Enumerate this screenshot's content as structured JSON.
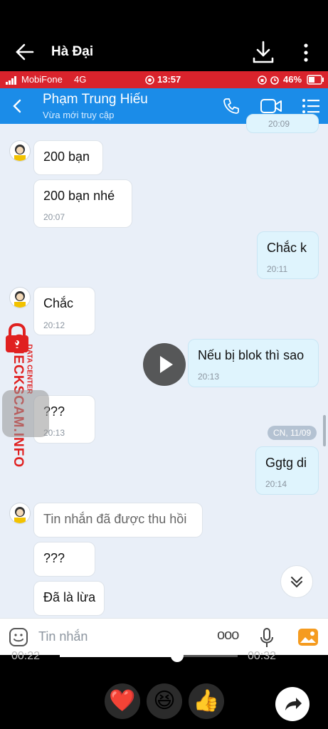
{
  "viewer": {
    "title": "Hà Đại",
    "icons": [
      "back-arrow-icon",
      "download-icon",
      "more-vert-icon"
    ]
  },
  "status_bar": {
    "carrier": "MobiFone",
    "network": "4G",
    "time": "13:57",
    "battery": "46%"
  },
  "chat_header": {
    "name": "Phạm Trung Hiếu",
    "status": "Vừa mới truy cập",
    "icons": [
      "back-icon",
      "phone-icon",
      "video-icon",
      "menu-icon"
    ]
  },
  "messages": [
    {
      "from": "them",
      "text": "200 bạn",
      "time": ""
    },
    {
      "from": "them",
      "text": "200 bạn nhé",
      "time": "20:07"
    },
    {
      "from": "me",
      "text": "Chắc k",
      "time": "20:11"
    },
    {
      "from": "them",
      "text": "Chắc",
      "time": "20:12"
    },
    {
      "from": "me",
      "text": "Nếu bị blok thì sao",
      "time": "20:13"
    },
    {
      "from": "them",
      "text": "???",
      "time": "20:13"
    },
    {
      "from": "me",
      "text": "Ggtg di",
      "time": "20:14"
    },
    {
      "from": "them",
      "text": "Tin nhắn đã được thu hồi",
      "time": ""
    },
    {
      "from": "them",
      "text": "???",
      "time": ""
    },
    {
      "from": "them",
      "text": "Đã là lừa",
      "time": ""
    }
  ],
  "top_partial_time": "20:09",
  "date_separator": "CN, 11/09",
  "input": {
    "placeholder": "Tin nhắn",
    "more": "ooo"
  },
  "watermark": {
    "main": "CHECKSCAM.INFO",
    "sub": "DATA CENTER"
  },
  "player": {
    "current_time": "00:22",
    "total_time": "00:32",
    "progress": 0.66,
    "reactions": [
      "❤️",
      "😆",
      "👍"
    ]
  },
  "colors": {
    "accent": "#1b8ce8",
    "status_bar": "#d9232c",
    "my_bubble": "#dff4fd"
  }
}
